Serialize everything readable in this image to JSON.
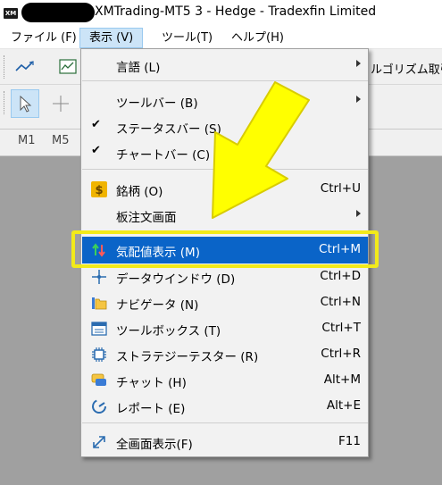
{
  "window": {
    "title": "XMTrading-MT5 3 - Hedge - Tradexfin Limited",
    "logo_text": "XM"
  },
  "menubar": {
    "items": [
      {
        "label": "ファイル (F)"
      },
      {
        "label": "表示 (V)"
      },
      {
        "label": "ツール(T)"
      },
      {
        "label": "ヘルプ(H)"
      }
    ]
  },
  "toolbar": {
    "algo_label": "ルゴリズム取引",
    "timeframes": [
      "M1",
      "M5"
    ]
  },
  "view_menu": {
    "items": [
      {
        "label": "言語 (L)",
        "submenu": true
      },
      {
        "label": "ツールバー (B)",
        "submenu": true
      },
      {
        "label": "ステータスバー (S)",
        "checked": true
      },
      {
        "label": "チャートバー (C)",
        "checked": true
      },
      {
        "label": "銘柄 (O)",
        "shortcut": "Ctrl+U",
        "icon": "dollar-icon"
      },
      {
        "label": "板注文画面",
        "submenu": true
      },
      {
        "label": "気配値表示 (M)",
        "shortcut": "Ctrl+M",
        "icon": "quotes-icon",
        "highlighted": true
      },
      {
        "label": "データウインドウ (D)",
        "shortcut": "Ctrl+D",
        "icon": "crosshair-icon"
      },
      {
        "label": "ナビゲータ (N)",
        "shortcut": "Ctrl+N",
        "icon": "folder-icon"
      },
      {
        "label": "ツールボックス (T)",
        "shortcut": "Ctrl+T",
        "icon": "toolbox-icon"
      },
      {
        "label": "ストラテジーテスター (R)",
        "shortcut": "Ctrl+R",
        "icon": "chip-icon"
      },
      {
        "label": "チャット (H)",
        "shortcut": "Alt+M",
        "icon": "chat-icon"
      },
      {
        "label": "レポート (E)",
        "shortcut": "Alt+E",
        "icon": "report-icon"
      },
      {
        "label": "全画面表示(F)",
        "shortcut": "F11",
        "icon": "fullscreen-icon"
      }
    ]
  },
  "colors": {
    "highlight": "#0a64c8",
    "annotation": "#f2ea1a"
  }
}
